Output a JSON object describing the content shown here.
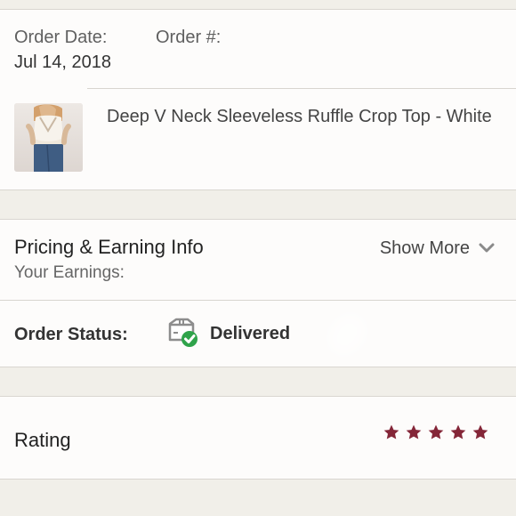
{
  "order": {
    "date_label": "Order Date:",
    "number_label": "Order #:",
    "date_value": "Jul 14, 2018"
  },
  "product": {
    "title": "Deep V Neck Sleeveless Ruffle Crop Top - White",
    "thumbnail_icon": "product-thumbnail"
  },
  "pricing": {
    "title": "Pricing & Earning Info",
    "show_more_label": "Show More",
    "earnings_label": "Your Earnings:"
  },
  "status": {
    "label": "Order Status:",
    "value": "Delivered",
    "icon": "delivered-box-icon",
    "check_color": "#2fa34a"
  },
  "rating": {
    "label": "Rating",
    "stars": 5,
    "star_color": "#842638"
  }
}
